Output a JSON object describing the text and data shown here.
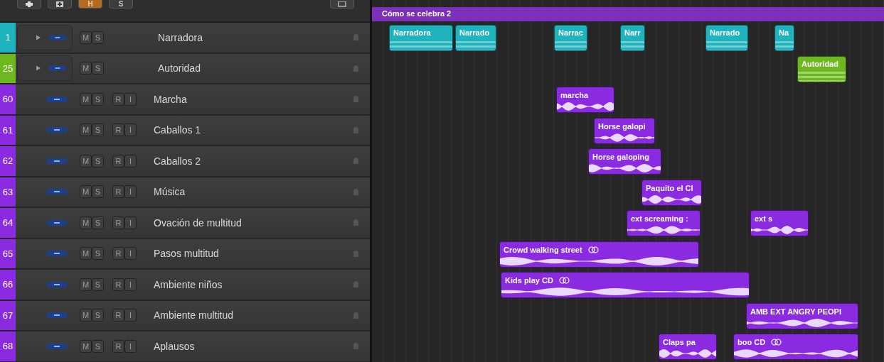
{
  "toolbar": {
    "buttons": [
      {
        "label": "H",
        "selected": true
      },
      {
        "label": "S",
        "selected": false
      }
    ]
  },
  "arrange": {
    "project_region": "Cómo se celebra 2"
  },
  "tracks": [
    {
      "number": "1",
      "name": "Narradora",
      "color": "#1fb3bd",
      "kind": "stack",
      "buttons": [
        "M",
        "S"
      ],
      "regions": [
        {
          "label": "Narradora",
          "looped": false
        },
        {
          "label": "Narrado",
          "looped": false
        },
        {
          "label": "Narrac",
          "looped": false
        },
        {
          "label": "Narr",
          "looped": false
        },
        {
          "label": "Narrado",
          "looped": false
        },
        {
          "label": "Na",
          "looped": false
        }
      ]
    },
    {
      "number": "25",
      "name": "Autoridad",
      "color": "#6cb81e",
      "kind": "stack",
      "buttons": [
        "M",
        "S"
      ],
      "regions": [
        {
          "label": "Autoridad",
          "looped": false
        }
      ]
    },
    {
      "number": "60",
      "name": "Marcha",
      "color": "#8a2be2",
      "kind": "audio",
      "buttons": [
        "M",
        "S",
        "R",
        "I"
      ],
      "regions": [
        {
          "label": "marcha",
          "looped": false
        }
      ]
    },
    {
      "number": "61",
      "name": "Caballos 1",
      "color": "#8a2be2",
      "kind": "audio",
      "buttons": [
        "M",
        "S",
        "R",
        "I"
      ],
      "regions": [
        {
          "label": "Horse galopi",
          "looped": false
        }
      ]
    },
    {
      "number": "62",
      "name": "Caballos 2",
      "color": "#8a2be2",
      "kind": "audio",
      "buttons": [
        "M",
        "S",
        "R",
        "I"
      ],
      "regions": [
        {
          "label": "Horse galoping",
          "looped": false
        }
      ]
    },
    {
      "number": "63",
      "name": "Música",
      "color": "#8a2be2",
      "kind": "audio",
      "buttons": [
        "M",
        "S",
        "R",
        "I"
      ],
      "regions": [
        {
          "label": "Paquito el Cl",
          "looped": false
        }
      ]
    },
    {
      "number": "64",
      "name": "Ovación de multitud",
      "color": "#8a2be2",
      "kind": "audio",
      "buttons": [
        "M",
        "S",
        "R",
        "I"
      ],
      "regions": [
        {
          "label": "ext screaming :",
          "looped": false
        },
        {
          "label": "ext s",
          "looped": false
        }
      ]
    },
    {
      "number": "65",
      "name": "Pasos multitud",
      "color": "#8a2be2",
      "kind": "audio",
      "buttons": [
        "M",
        "S",
        "R",
        "I"
      ],
      "regions": [
        {
          "label": "Crowd walking street",
          "looped": true
        }
      ]
    },
    {
      "number": "66",
      "name": "Ambiente niños",
      "color": "#8a2be2",
      "kind": "audio",
      "buttons": [
        "M",
        "S",
        "R",
        "I"
      ],
      "regions": [
        {
          "label": "Kids play CD",
          "looped": true
        }
      ]
    },
    {
      "number": "67",
      "name": "Ambiente multitud",
      "color": "#8a2be2",
      "kind": "audio",
      "buttons": [
        "M",
        "S",
        "R",
        "I"
      ],
      "regions": [
        {
          "label": "AMB EXT ANGRY PEOPI",
          "looped": false
        }
      ]
    },
    {
      "number": "68",
      "name": "Aplausos",
      "color": "#8a2be2",
      "kind": "audio",
      "buttons": [
        "M",
        "S",
        "R",
        "I"
      ],
      "regions": [
        {
          "label": "Claps pa",
          "looped": false
        },
        {
          "label": "boo CD",
          "looped": true
        }
      ]
    }
  ]
}
